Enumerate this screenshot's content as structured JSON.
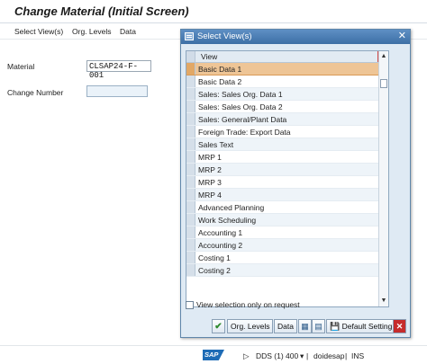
{
  "window": {
    "title": "Change Material (Initial Screen)"
  },
  "menu": {
    "items": [
      "Select View(s)",
      "Org. Levels",
      "Data"
    ]
  },
  "form": {
    "material_label": "Material",
    "material_value": "CLSAP24-F-001",
    "change_number_label": "Change Number",
    "change_number_value": ""
  },
  "dialog": {
    "title": "Select View(s)",
    "column_header": "View",
    "views": [
      "Basic Data 1",
      "Basic Data 2",
      "Sales: Sales Org. Data 1",
      "Sales: Sales Org. Data 2",
      "Sales: General/Plant Data",
      "Foreign Trade: Export Data",
      "Sales Text",
      "MRP 1",
      "MRP 2",
      "MRP 3",
      "MRP 4",
      "Advanced Planning",
      "Work Scheduling",
      "Accounting 1",
      "Accounting 2",
      "Costing 1",
      "Costing 2"
    ],
    "selected_index": 0,
    "checkbox_label": "View selection only on request",
    "buttons": {
      "org_levels": "Org. Levels",
      "data": "Data",
      "default_setting": "Default Setting"
    }
  },
  "status": {
    "system": "DDS (1) 400",
    "server": "doidesap",
    "mode": "INS"
  },
  "colors": {
    "title_bar": "#3d6fa5",
    "selected_row": "#eec596",
    "dialog_bg": "#dfeaf4",
    "sap_blue": "#1e6cb6"
  }
}
